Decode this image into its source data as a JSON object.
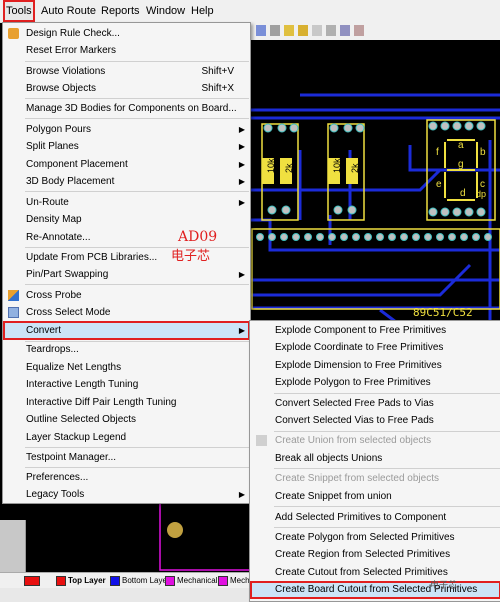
{
  "menubar": {
    "items": [
      {
        "label": "Tools"
      },
      {
        "label": "Auto Route"
      },
      {
        "label": "Reports"
      },
      {
        "label": "Window"
      },
      {
        "label": "Help"
      }
    ]
  },
  "tools_menu": {
    "items": [
      {
        "label": "Design Rule Check...",
        "shortcut": "",
        "icon": "drc-icon"
      },
      {
        "label": "Reset Error Markers",
        "shortcut": ""
      },
      {
        "label": "Browse Violations",
        "shortcut": "Shift+V"
      },
      {
        "label": "Browse Objects",
        "shortcut": "Shift+X"
      },
      {
        "label": "Manage 3D Bodies for Components on Board...",
        "shortcut": ""
      },
      {
        "label": "Polygon Pours",
        "submenu": true
      },
      {
        "label": "Split Planes",
        "submenu": true
      },
      {
        "label": "Component Placement",
        "submenu": true
      },
      {
        "label": "3D Body Placement",
        "submenu": true
      },
      {
        "label": "Un-Route",
        "submenu": true
      },
      {
        "label": "Density Map"
      },
      {
        "label": "Re-Annotate..."
      },
      {
        "label": "Update From PCB Libraries..."
      },
      {
        "label": "Pin/Part Swapping",
        "submenu": true
      },
      {
        "label": "Cross Probe",
        "icon": "cross-probe-icon"
      },
      {
        "label": "Cross Select Mode",
        "icon": "cross-select-icon"
      },
      {
        "label": "Convert",
        "submenu": true
      },
      {
        "label": "Teardrops..."
      },
      {
        "label": "Equalize Net Lengths"
      },
      {
        "label": "Interactive Length Tuning"
      },
      {
        "label": "Interactive Diff Pair Length Tuning"
      },
      {
        "label": "Outline Selected Objects"
      },
      {
        "label": "Layer Stackup Legend"
      },
      {
        "label": "Testpoint Manager..."
      },
      {
        "label": "Preferences..."
      },
      {
        "label": "Legacy Tools",
        "submenu": true
      }
    ]
  },
  "convert_submenu": {
    "items": [
      {
        "label": "Explode Component to Free Primitives"
      },
      {
        "label": "Explode Coordinate to Free Primitives"
      },
      {
        "label": "Explode Dimension to Free Primitives"
      },
      {
        "label": "Explode Polygon to Free Primitives"
      },
      {
        "label": "Convert Selected Free Pads to Vias"
      },
      {
        "label": "Convert Selected Vias to Free Pads"
      },
      {
        "label": "Create Union from selected objects",
        "disabled": true
      },
      {
        "label": "Break all objects Unions"
      },
      {
        "label": "Create Snippet from selected objects",
        "disabled": true
      },
      {
        "label": "Create Snippet from union"
      },
      {
        "label": "Add Selected Primitives to Component"
      },
      {
        "label": "Create Polygon from Selected Primitives"
      },
      {
        "label": "Create Region from Selected Primitives"
      },
      {
        "label": "Create Cutout from Selected Primitives"
      },
      {
        "label": "Create Board Cutout from Selected Primitives"
      }
    ]
  },
  "pcb": {
    "silk_labels": [
      "10k",
      "2k",
      "10k",
      "2k",
      "89C51/C52"
    ],
    "display_labels": [
      "a",
      "b",
      "f",
      "g",
      "e",
      "c",
      "d",
      "dp"
    ]
  },
  "layer_tabs": [
    {
      "label": "Top Layer",
      "color": "#e81010"
    },
    {
      "label": "Bottom Layer",
      "color": "#1010e8"
    },
    {
      "label": "Mechanical 1",
      "color": "#e010e0"
    },
    {
      "label": "Mechan",
      "color": "#e010e0"
    }
  ],
  "watermark": {
    "line1": "AD09",
    "line2": "电子芯",
    "corner": "电子芯"
  },
  "colors": {
    "board": "#000000",
    "trace": "#1b2bd8",
    "silk": "#f0e040",
    "pad": "#c0c0c0",
    "outline": "#e010e0",
    "highlight": "#e02020"
  }
}
